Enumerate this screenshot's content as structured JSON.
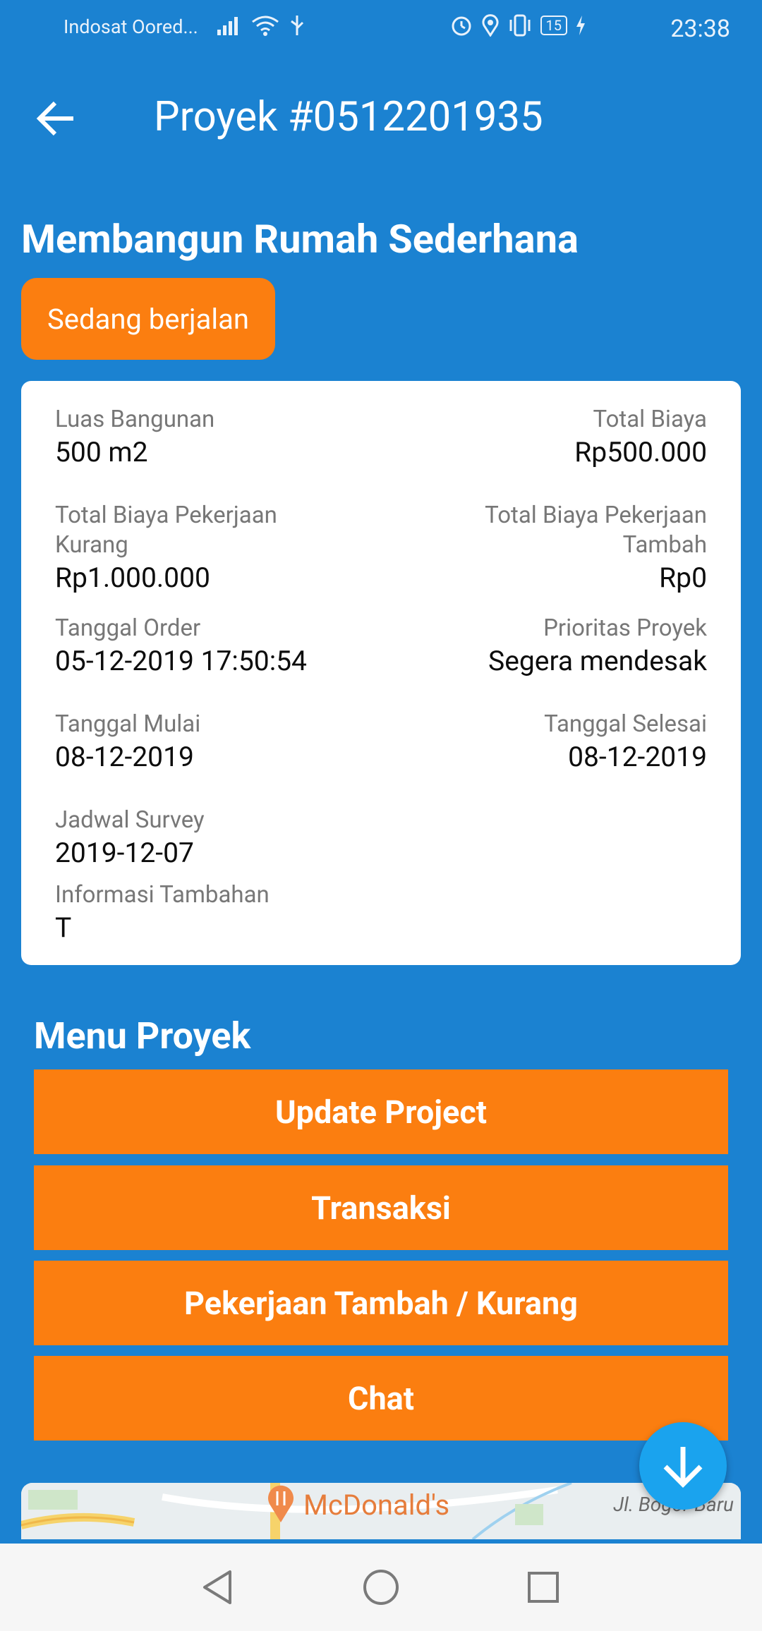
{
  "status_bar": {
    "carrier": "Indosat Oored...",
    "battery": "15",
    "time": "23:38"
  },
  "app_bar": {
    "title": "Proyek #0512201935"
  },
  "project": {
    "title": "Membangun Rumah Sederhana",
    "status": "Sedang berjalan",
    "status_color": "#fb7e10"
  },
  "details": {
    "luas_bangunan": {
      "label": "Luas Bangunan",
      "value": "500 m2"
    },
    "total_biaya": {
      "label": "Total Biaya",
      "value": "Rp500.000"
    },
    "biaya_kurang": {
      "label_line1": "Total Biaya Pekerjaan",
      "label_line2": "Kurang",
      "value": "Rp1.000.000"
    },
    "biaya_tambah": {
      "label_line1": "Total Biaya Pekerjaan",
      "label_line2": "Tambah",
      "value": "Rp0"
    },
    "tanggal_order": {
      "label": "Tanggal Order",
      "value": "05-12-2019 17:50:54"
    },
    "prioritas": {
      "label": "Prioritas Proyek",
      "value": "Segera mendesak"
    },
    "tanggal_mulai": {
      "label": "Tanggal Mulai",
      "value": "08-12-2019"
    },
    "tanggal_selesai": {
      "label": "Tanggal Selesai",
      "value": "08-12-2019"
    },
    "jadwal_survey": {
      "label": "Jadwal Survey",
      "value": "2019-12-07"
    },
    "info_tambahan": {
      "label": "Informasi Tambahan",
      "value": "T"
    }
  },
  "menu": {
    "title": "Menu Proyek",
    "buttons": [
      "Update Project",
      "Transaksi",
      "Pekerjaan Tambah / Kurang",
      "Chat"
    ]
  },
  "map": {
    "poi": "McDonald's",
    "road": "Jl. Bogor Baru"
  },
  "icons": {
    "back": "arrow-left-icon",
    "fab": "arrow-down-icon",
    "nav_back": "triangle-back-icon",
    "nav_home": "circle-home-icon",
    "nav_recent": "square-recent-icon"
  },
  "colors": {
    "background": "#1b82d1",
    "accent": "#fb7e10",
    "fab": "#1aa3ee"
  }
}
